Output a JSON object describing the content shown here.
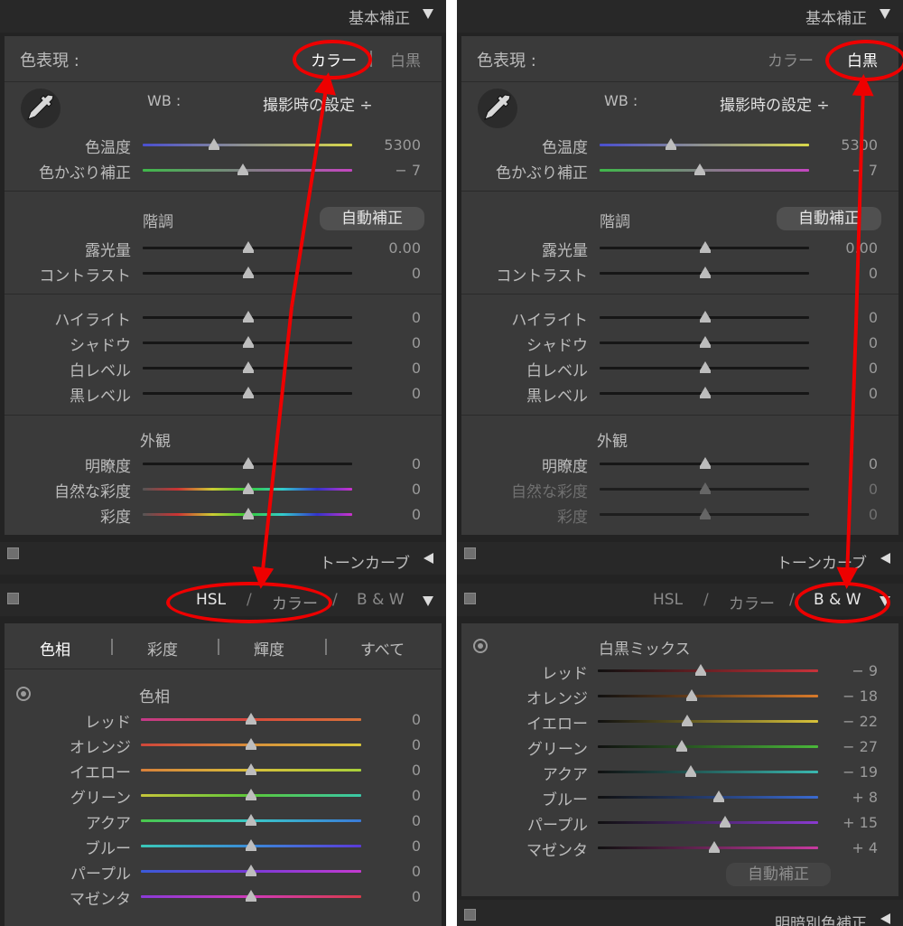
{
  "left": {
    "header_title": "基本補正",
    "treatment": {
      "label": "色表現 :",
      "color": "カラー",
      "bw": "白黒"
    },
    "wb": {
      "label": "WB :",
      "value": "撮影時の設定 ÷"
    },
    "temp": {
      "label": "色温度",
      "value": "5300"
    },
    "tint": {
      "label": "色かぶり補正",
      "value": "− 7"
    },
    "tone_title": "階調",
    "auto_button": "自動補正",
    "exposure": {
      "label": "露光量",
      "value": "0.00"
    },
    "contrast": {
      "label": "コントラスト",
      "value": "0"
    },
    "highlights": {
      "label": "ハイライト",
      "value": "0"
    },
    "shadows": {
      "label": "シャドウ",
      "value": "0"
    },
    "whites": {
      "label": "白レベル",
      "value": "0"
    },
    "blacks": {
      "label": "黒レベル",
      "value": "0"
    },
    "presence_title": "外観",
    "clarity": {
      "label": "明瞭度",
      "value": "0"
    },
    "vibrance": {
      "label": "自然な彩度",
      "value": "0"
    },
    "saturation": {
      "label": "彩度",
      "value": "0"
    },
    "tone_curve_title": "トーンカーブ",
    "hsl_tabs": {
      "hsl": "HSL",
      "color": "カラー",
      "bw": "B & W",
      "slash": "/"
    },
    "subtabs": [
      "色相",
      "彩度",
      "輝度",
      "すべて"
    ],
    "hue_title": "色相",
    "hue_rows": [
      {
        "label": "レッド",
        "value": "0"
      },
      {
        "label": "オレンジ",
        "value": "0"
      },
      {
        "label": "イエロー",
        "value": "0"
      },
      {
        "label": "グリーン",
        "value": "0"
      },
      {
        "label": "アクア",
        "value": "0"
      },
      {
        "label": "ブルー",
        "value": "0"
      },
      {
        "label": "パープル",
        "value": "0"
      },
      {
        "label": "マゼンタ",
        "value": "0"
      }
    ]
  },
  "right": {
    "header_title": "基本補正",
    "treatment": {
      "label": "色表現 :",
      "color": "カラー",
      "bw": "白黒"
    },
    "wb": {
      "label": "WB :",
      "value": "撮影時の設定 ÷"
    },
    "temp": {
      "label": "色温度",
      "value": "5300"
    },
    "tint": {
      "label": "色かぶり補正",
      "value": "− 7"
    },
    "tone_title": "階調",
    "auto_button": "自動補正",
    "exposure": {
      "label": "露光量",
      "value": "0.00"
    },
    "contrast": {
      "label": "コントラスト",
      "value": "0"
    },
    "highlights": {
      "label": "ハイライト",
      "value": "0"
    },
    "shadows": {
      "label": "シャドウ",
      "value": "0"
    },
    "whites": {
      "label": "白レベル",
      "value": "0"
    },
    "blacks": {
      "label": "黒レベル",
      "value": "0"
    },
    "presence_title": "外観",
    "clarity": {
      "label": "明瞭度",
      "value": "0"
    },
    "vibrance": {
      "label": "自然な彩度",
      "value": "0"
    },
    "saturation": {
      "label": "彩度",
      "value": "0"
    },
    "tone_curve_title": "トーンカーブ",
    "hsl_tabs": {
      "hsl": "HSL",
      "color": "カラー",
      "bw": "B & W",
      "slash": "/"
    },
    "bw_mix_title": "白黒ミックス",
    "bw_rows": [
      {
        "label": "レッド",
        "value": "− 9"
      },
      {
        "label": "オレンジ",
        "value": "− 18"
      },
      {
        "label": "イエロー",
        "value": "− 22"
      },
      {
        "label": "グリーン",
        "value": "− 27"
      },
      {
        "label": "アクア",
        "value": "− 19"
      },
      {
        "label": "ブルー",
        "value": "+ 8"
      },
      {
        "label": "パープル",
        "value": "+ 15"
      },
      {
        "label": "マゼンタ",
        "value": "+ 4"
      }
    ],
    "bw_auto_button": "自動補正",
    "split_toning_title": "明暗別色補正"
  },
  "colors": {
    "annotation": "#ee0000",
    "panel_bg": "#3a3a3a"
  }
}
